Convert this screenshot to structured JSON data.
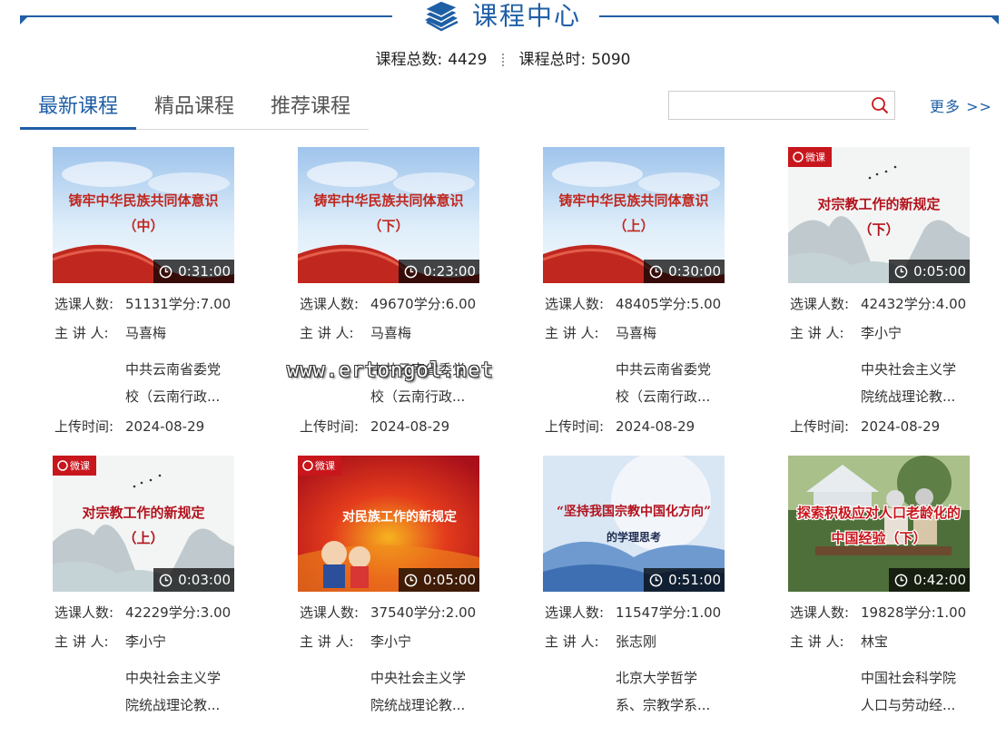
{
  "header": {
    "title": "课程中心"
  },
  "stats": {
    "total_courses_label": "课程总数:",
    "total_courses_value": "4429",
    "total_hours_label": "课程总时:",
    "total_hours_value": "5090"
  },
  "tabs": [
    {
      "label": "最新课程",
      "active": true
    },
    {
      "label": "精品课程",
      "active": false
    },
    {
      "label": "推荐课程",
      "active": false
    }
  ],
  "search": {
    "value": "",
    "placeholder": ""
  },
  "more_link": "更多 >>",
  "labels": {
    "enrolled": "选课人数:",
    "credits": "学分:",
    "lecturer": "主 讲 人:",
    "uploaded": "上传时间:"
  },
  "courses": [
    {
      "thumb_title": "铸牢中华民族共同体意识",
      "thumb_sub": "（中）",
      "badge": "",
      "duration": "0:31:00",
      "enrolled": "51131",
      "credits": "7.00",
      "lecturer": "马喜梅",
      "org_line1": "中共云南省委党",
      "org_line2": "校（云南行政...",
      "date": "2024-08-29"
    },
    {
      "thumb_title": "铸牢中华民族共同体意识",
      "thumb_sub": "（下）",
      "badge": "",
      "duration": "0:23:00",
      "enrolled": "49670",
      "credits": "6.00",
      "lecturer": "马喜梅",
      "org_line1": "中共云南省委党",
      "org_line2": "校（云南行政...",
      "date": "2024-08-29"
    },
    {
      "thumb_title": "铸牢中华民族共同体意识",
      "thumb_sub": "（上）",
      "badge": "",
      "duration": "0:30:00",
      "enrolled": "48405",
      "credits": "5.00",
      "lecturer": "马喜梅",
      "org_line1": "中共云南省委党",
      "org_line2": "校（云南行政...",
      "date": "2024-08-29"
    },
    {
      "thumb_title": "对宗教工作的新规定",
      "thumb_sub": "（下）",
      "badge": "微课",
      "duration": "0:05:00",
      "enrolled": "42432",
      "credits": "4.00",
      "lecturer": "李小宁",
      "org_line1": "中央社会主义学",
      "org_line2": "院统战理论教...",
      "date": "2024-08-29"
    },
    {
      "thumb_title": "对宗教工作的新规定",
      "thumb_sub": "（上）",
      "badge": "微课",
      "duration": "0:03:00",
      "enrolled": "42229",
      "credits": "3.00",
      "lecturer": "李小宁",
      "org_line1": "中央社会主义学",
      "org_line2": "院统战理论教...",
      "date": ""
    },
    {
      "thumb_title": "对民族工作的新规定",
      "thumb_sub": "",
      "badge": "微课",
      "duration": "0:05:00",
      "enrolled": "37540",
      "credits": "2.00",
      "lecturer": "李小宁",
      "org_line1": "中央社会主义学",
      "org_line2": "院统战理论教...",
      "date": ""
    },
    {
      "thumb_title": "“坚持我国宗教中国化方向”",
      "thumb_sub": "的学理思考",
      "badge": "",
      "duration": "0:51:00",
      "enrolled": "11547",
      "credits": "1.00",
      "lecturer": "张志刚",
      "org_line1": "北京大学哲学",
      "org_line2": "系、宗教学系...",
      "date": ""
    },
    {
      "thumb_title": "探索积极应对人口老龄化的",
      "thumb_sub": "中国经验（下）",
      "badge": "",
      "duration": "0:42:00",
      "enrolled": "19828",
      "credits": "1.00",
      "lecturer": "林宝",
      "org_line1": "中国社会科学院",
      "org_line2": "人口与劳动经...",
      "date": ""
    }
  ],
  "watermark": "www.ertongol.net",
  "colors": {
    "accent": "#1f5fa6",
    "badge_red": "#c8161d",
    "thumb_red": "#c0281f"
  }
}
